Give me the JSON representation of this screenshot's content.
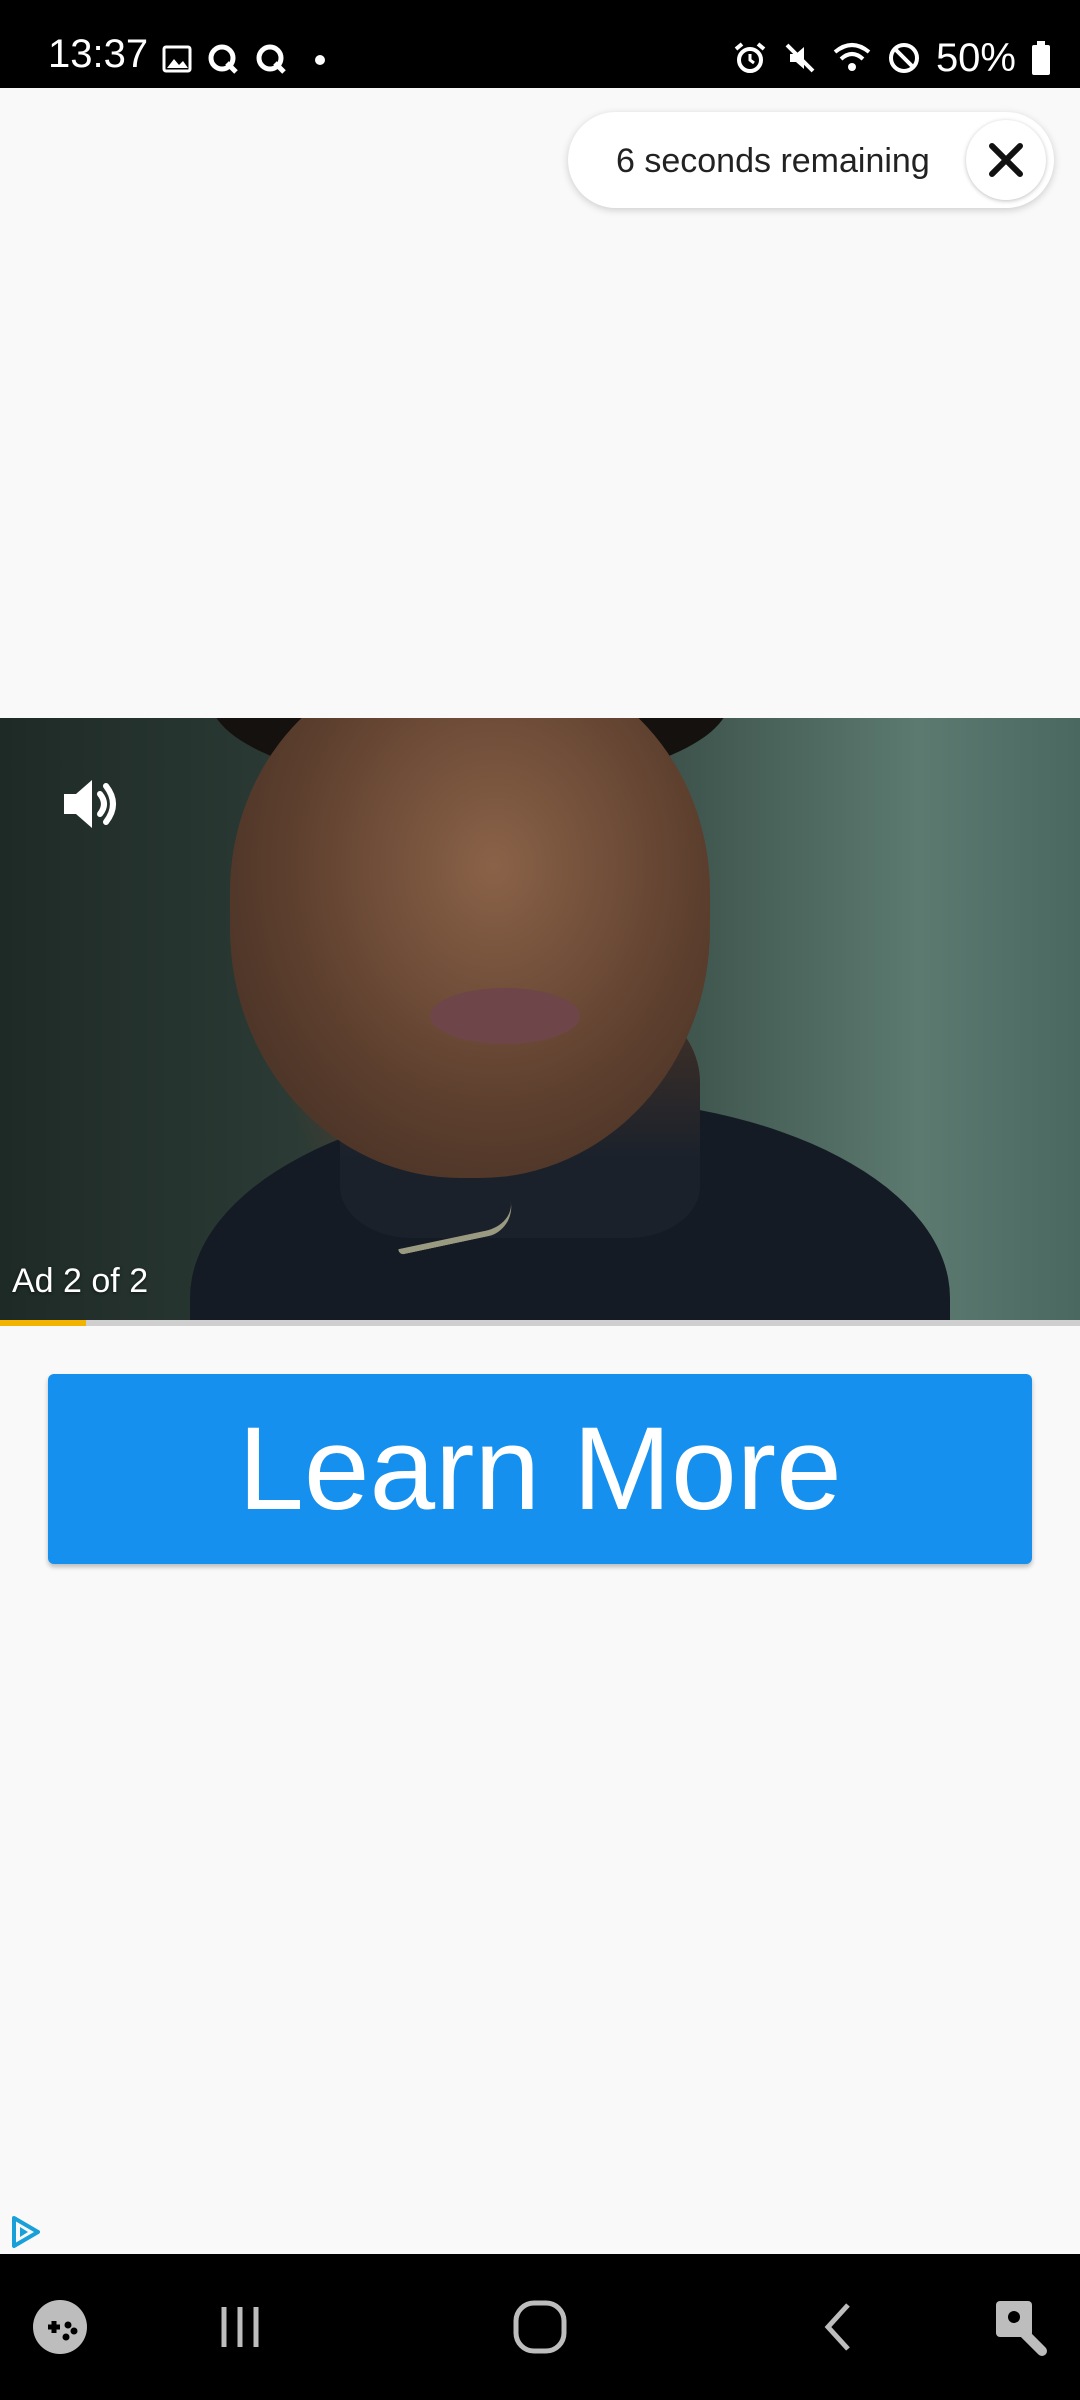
{
  "status_bar": {
    "time": "13:37",
    "battery": "50%",
    "left_icons": [
      "image-icon",
      "q-app-icon",
      "q-app-icon",
      "notification-dot-icon"
    ],
    "right_icons": [
      "alarm-icon",
      "mute-icon",
      "wifi-icon",
      "do-not-disturb-icon",
      "battery-icon"
    ]
  },
  "ad": {
    "countdown_text": "6 seconds remaining",
    "counter_text": "Ad 2 of 2",
    "progress_fraction": 0.08,
    "cta_label": "Learn More",
    "cta_color": "#1590ee",
    "progress_color": "#f2b400"
  },
  "nav_bar": {
    "items": [
      "game-launcher-icon",
      "recent-apps-icon",
      "home-icon",
      "back-icon",
      "assistant-icon"
    ]
  }
}
